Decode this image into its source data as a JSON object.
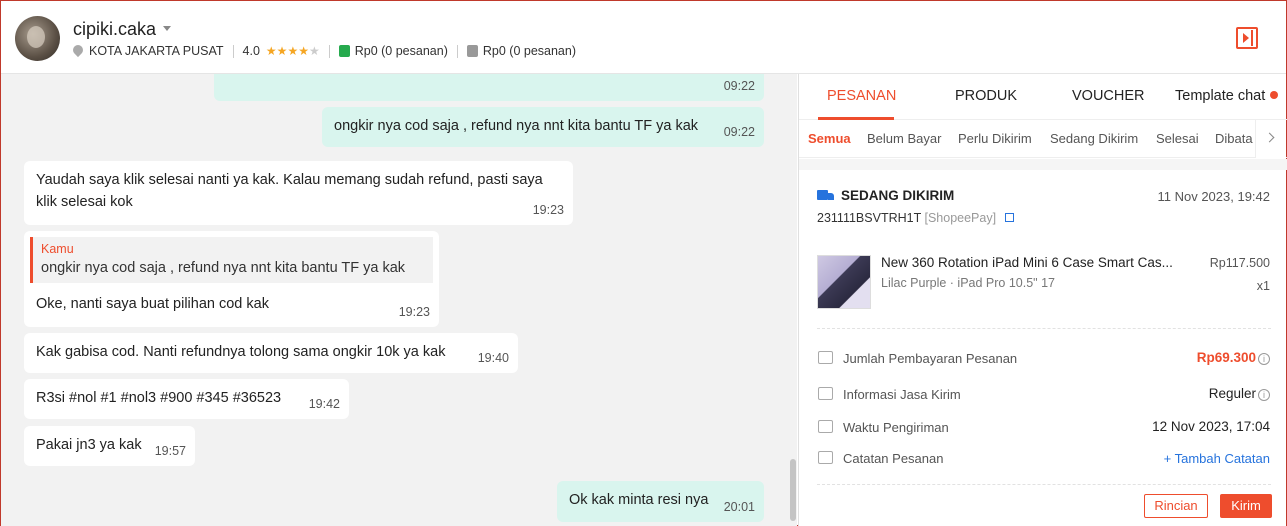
{
  "header": {
    "username": "cipiki.caka",
    "location": "KOTA JAKARTA PUSAT",
    "rating": "4.0",
    "stars": "★★★★",
    "star_off": "★",
    "paid_amount": "Rp0",
    "paid_orders": "(0 pesanan)",
    "unpaid_amount": "Rp0",
    "unpaid_orders": "(0 pesanan)"
  },
  "chat": {
    "messages": [
      {
        "text": "ongkir nya cod saja , refund nya nnt kita bantu TF ya kak",
        "time": "09:22"
      },
      {
        "text": "Yaudah saya klik selesai nanti ya kak. Kalau memang sudah refund, pasti saya klik selesai kok",
        "time": "19:23"
      },
      {
        "quote_author": "Kamu",
        "quote_text": "ongkir nya cod saja , refund nya nnt kita bantu TF ya kak",
        "text": "Oke, nanti saya buat pilihan cod kak",
        "time": "19:23"
      },
      {
        "text": "Kak gabisa cod. Nanti refundnya tolong sama ongkir 10k ya kak",
        "time": "19:40"
      },
      {
        "text": "R3si #nol #1 #nol3 #900 #345 #36523",
        "time": "19:42"
      },
      {
        "text": "Pakai jn3 ya kak",
        "time": "19:57"
      },
      {
        "text": "Ok kak minta resi nya",
        "time": "20:01"
      }
    ],
    "partial_time": "09:22"
  },
  "side": {
    "tabs": [
      "PESANAN",
      "PRODUK",
      "VOUCHER",
      "Template chat"
    ],
    "subtabs": [
      "Semua",
      "Belum Bayar",
      "Perlu Dikirim",
      "Sedang Dikirim",
      "Selesai",
      "Dibata"
    ],
    "order": {
      "status": "SEDANG DIKIRIM",
      "date": "11 Nov 2023, 19:42",
      "id": "231111BSVTRH1T",
      "payment": "[ShopeePay]",
      "product_name": "New 360 Rotation iPad Mini 6 Case Smart Cas...",
      "variation": "Lilac Purple · iPad Pro 10.5\" 17",
      "price": "Rp117.500",
      "qty": "x1",
      "rows": {
        "payment_label": "Jumlah Pembayaran Pesanan",
        "payment_value": "Rp69.300",
        "courier_label": "Informasi Jasa Kirim",
        "courier_value": "Reguler",
        "ship_time_label": "Waktu Pengiriman",
        "ship_time_value": "12 Nov 2023, 17:04",
        "note_label": "Catatan Pesanan",
        "note_action": "+ Tambah Catatan"
      },
      "buttons": {
        "details": "Rincian",
        "send": "Kirim"
      }
    }
  },
  "colors": {
    "accent": "#ee4d2d",
    "outgoing_bubble": "#d9f5ee",
    "chat_bg": "#f2f2f2",
    "link": "#2673dd"
  }
}
